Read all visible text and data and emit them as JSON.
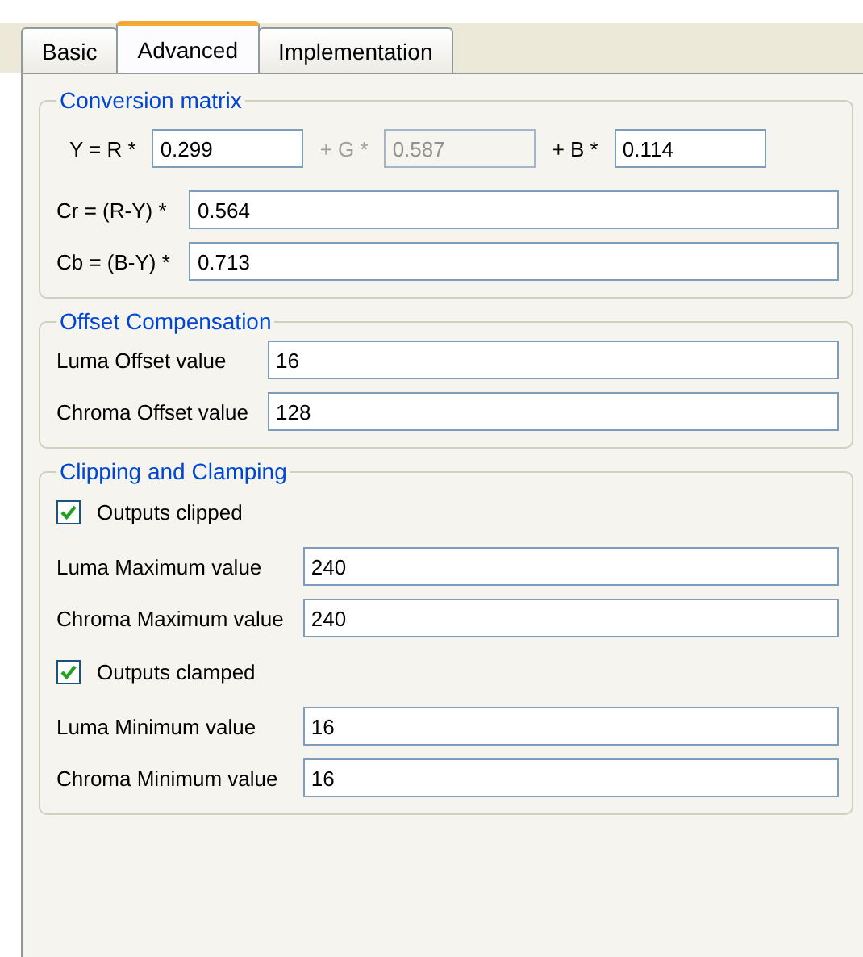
{
  "tabs": [
    {
      "label": "Basic",
      "selected": false
    },
    {
      "label": "Advanced",
      "selected": true
    },
    {
      "label": "Implementation",
      "selected": false
    }
  ],
  "groups": [
    {
      "title": "Conversion matrix",
      "rows": [
        {
          "kind": "triple",
          "parts": [
            {
              "kind": "label",
              "text": "Y = R *",
              "disabled": false
            },
            {
              "kind": "input",
              "value": "0.299",
              "disabled": false
            },
            {
              "kind": "label",
              "text": "+ G *",
              "disabled": true
            },
            {
              "kind": "input",
              "value": "0.587",
              "disabled": true
            },
            {
              "kind": "label",
              "text": "+ B *",
              "disabled": false
            },
            {
              "kind": "input",
              "value": "0.114",
              "disabled": false
            }
          ]
        },
        {
          "kind": "field",
          "label": "Cr = (R-Y) *",
          "value": "0.564"
        },
        {
          "kind": "field",
          "label": "Cb = (B-Y) *",
          "value": "0.713"
        }
      ]
    },
    {
      "title": "Offset Compensation",
      "rows": [
        {
          "kind": "field",
          "label": "Luma Offset value",
          "value": "16"
        },
        {
          "kind": "field",
          "label": "Chroma Offset value",
          "value": "128"
        }
      ]
    },
    {
      "title": "Clipping and Clamping",
      "rows": [
        {
          "kind": "checkbox",
          "label": "Outputs clipped",
          "checked": true
        },
        {
          "kind": "field",
          "label": "Luma Maximum value",
          "value": "240"
        },
        {
          "kind": "field",
          "label": "Chroma Maximum value",
          "value": "240"
        },
        {
          "kind": "checkbox",
          "label": "Outputs clamped",
          "checked": true
        },
        {
          "kind": "field",
          "label": "Luma Minimum value",
          "value": "16"
        },
        {
          "kind": "field",
          "label": "Chroma Minimum value",
          "value": "16"
        }
      ]
    }
  ]
}
